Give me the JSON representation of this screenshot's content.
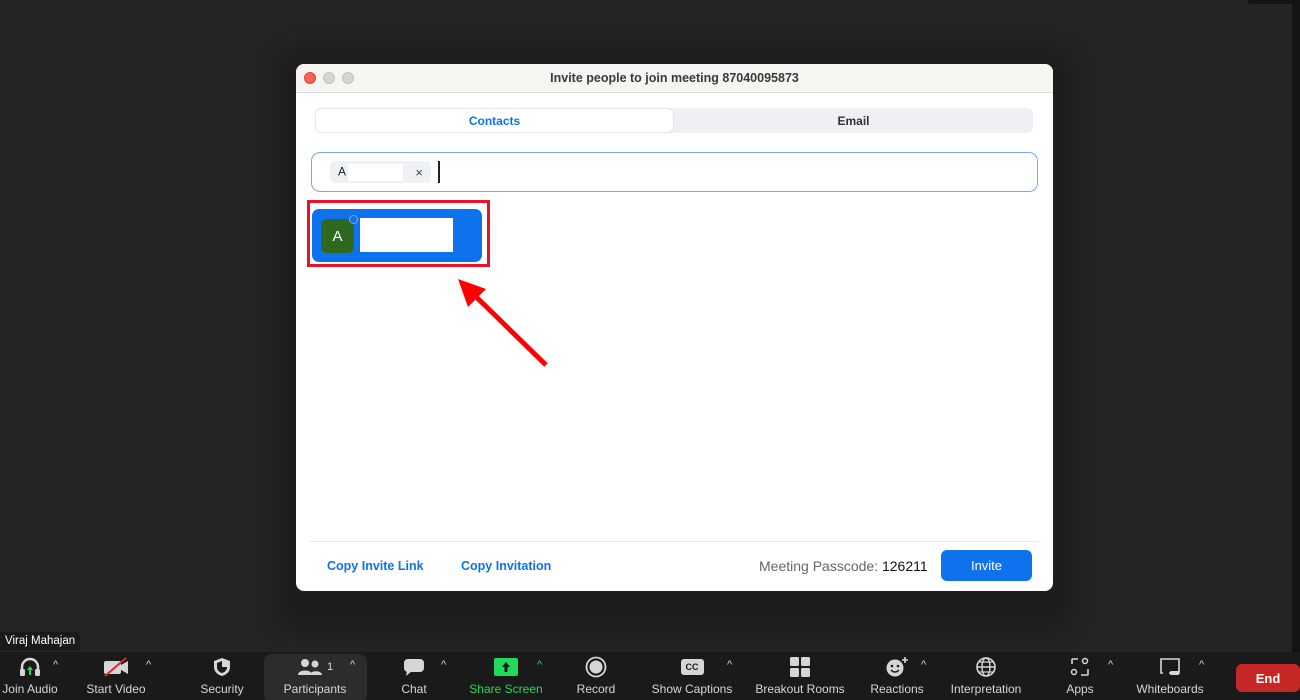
{
  "dialog": {
    "title": "Invite people to join meeting 87040095873",
    "tabs": [
      {
        "label": "Contacts",
        "active": true
      },
      {
        "label": "Email",
        "active": false
      }
    ],
    "search": {
      "chip_label": "A",
      "chip_remove": "×",
      "value": ""
    },
    "result": {
      "avatar_initial": "A",
      "highlighted": true
    },
    "footer": {
      "copy_invite_link": "Copy Invite Link",
      "copy_invitation": "Copy Invitation",
      "passcode_label": "Meeting Passcode:",
      "passcode_value": "126211",
      "invite_label": "Invite"
    }
  },
  "annotation": {
    "highlight_color": "#e8132a",
    "arrow_color": "#ff0000"
  },
  "participant_name": "Viraj Mahajan",
  "toolbar": {
    "items": [
      {
        "label": "Join Audio",
        "icon": "headphones-icon"
      },
      {
        "label": "Start Video",
        "icon": "video-off-icon"
      },
      {
        "label": "Security",
        "icon": "shield-icon"
      },
      {
        "label": "Participants",
        "icon": "participants-icon",
        "count": "1"
      },
      {
        "label": "Chat",
        "icon": "chat-icon"
      },
      {
        "label": "Share Screen",
        "icon": "share-screen-icon"
      },
      {
        "label": "Record",
        "icon": "record-icon"
      },
      {
        "label": "Show Captions",
        "icon": "captions-icon",
        "badge": "CC"
      },
      {
        "label": "Breakout Rooms",
        "icon": "breakout-rooms-icon"
      },
      {
        "label": "Reactions",
        "icon": "reactions-icon"
      },
      {
        "label": "Interpretation",
        "icon": "globe-icon"
      },
      {
        "label": "Apps",
        "icon": "apps-icon"
      },
      {
        "label": "Whiteboards",
        "icon": "whiteboard-icon"
      }
    ],
    "end_label": "End"
  },
  "colors": {
    "accent": "#0e72ed",
    "share_green": "#23d959",
    "end_red": "#c72626",
    "avatar_green": "#2d6a1f"
  }
}
